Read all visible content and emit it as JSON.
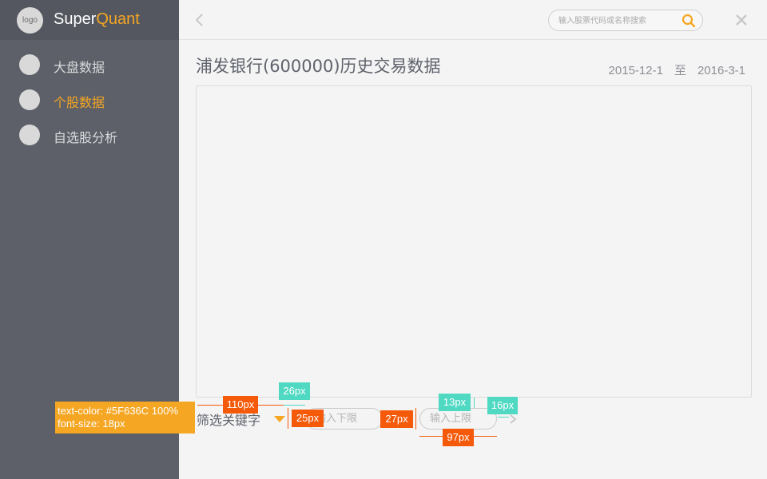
{
  "sidebar": {
    "logo_text": "logo",
    "brand_prefix": "Super",
    "brand_accent": "Quant",
    "items": [
      {
        "label": "大盘数据",
        "active": false
      },
      {
        "label": "个股数据",
        "active": true
      },
      {
        "label": "自选股分析",
        "active": false
      }
    ]
  },
  "topbar": {
    "search_placeholder": "输入股票代码或名称搜索"
  },
  "main": {
    "title": "浦发银行(600000)历史交易数据",
    "date_start": "2015-12-1",
    "date_sep": "至",
    "date_end": "2016-3-1"
  },
  "filter": {
    "label": "筛选关键字",
    "lower_placeholder": "输入下限",
    "upper_placeholder": "输入上限"
  },
  "annotations": {
    "spec_color": "text-color: #5F636C 100%",
    "spec_size": "font-size: 18px",
    "gap_110": "110px",
    "gap_26": "26px",
    "gap_25": "25px",
    "gap_27": "27px",
    "gap_13": "13px",
    "gap_16": "16px",
    "width_97": "97px"
  },
  "colors": {
    "accent": "#f5a623",
    "sidebar_bg": "#5d6068",
    "text": "#5f636c"
  },
  "icons": [
    "back-icon",
    "search-icon",
    "close-icon",
    "dropdown-arrow-icon",
    "next-icon"
  ]
}
